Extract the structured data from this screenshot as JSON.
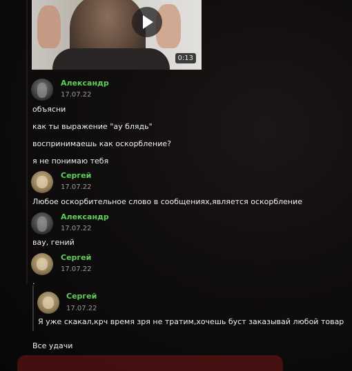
{
  "video": {
    "duration": "0:13",
    "play_icon": "play-icon"
  },
  "messages": [
    {
      "author": "Александр",
      "date": "17.07.22",
      "lines": [
        "объясни",
        "как ты выражение \"ау блядь\"",
        "воспринимаешь как оскорбление?",
        "я не понимаю тебя"
      ]
    },
    {
      "author": "Сергей",
      "date": "17.07.22",
      "lines": [
        "Любое оскорбительное слово в сообщениях,является оскорбление"
      ]
    },
    {
      "author": "Александр",
      "date": "17.07.22",
      "lines": [
        "вау, гений"
      ]
    },
    {
      "author": "Сергей",
      "date": "17.07.22",
      "lines": [
        "."
      ]
    }
  ],
  "quoted": {
    "author": "Сергей",
    "date": "17.07.22",
    "text": "Я уже скакал,крч время зря не тратим,хочешь буст заказывай любой товар"
  },
  "last_line": "Все удачи",
  "colors": {
    "name": "#5fcf5b",
    "text": "#f0f0f0",
    "date": "#9c9c9c",
    "background": "#0d0b0b"
  }
}
